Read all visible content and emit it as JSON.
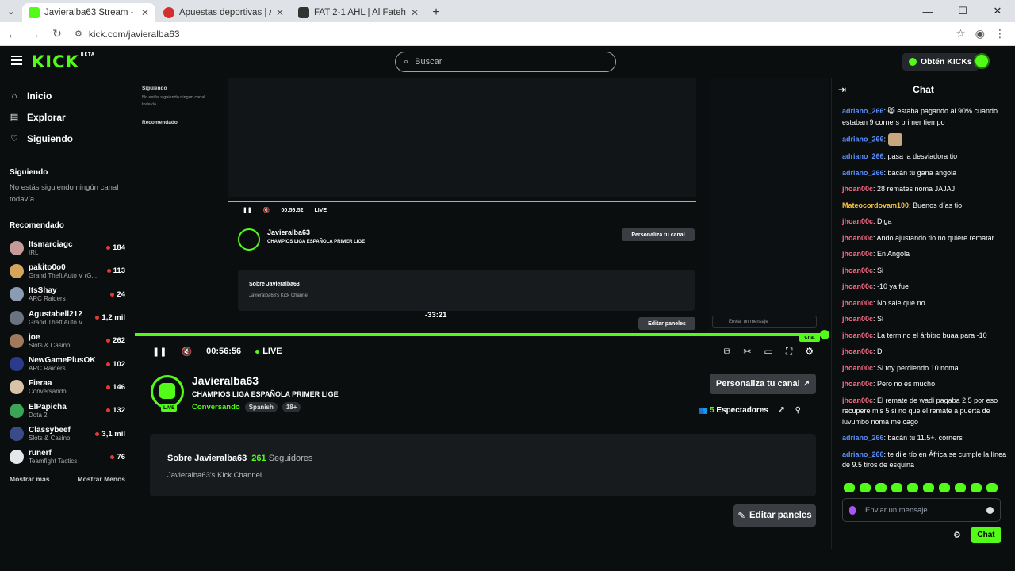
{
  "browser": {
    "tabs": [
      {
        "title": "Javieralba63 Stream - Watch Li",
        "active": true,
        "favicon_color": "#53fc18"
      },
      {
        "title": "Apuestas deportivas | Apuestas",
        "active": false,
        "favicon_color": "#d32f2f"
      },
      {
        "title": "FAT 2-1 AHL | Al Fateh vs Al Ahl",
        "active": false,
        "favicon_color": "#333333"
      }
    ],
    "url": "kick.com/javieralba63"
  },
  "header": {
    "logo": "KICK",
    "logo_badge": "BETA",
    "search_placeholder": "Buscar",
    "get_kicks": "Obtén KICKs"
  },
  "sidebar": {
    "nav": [
      {
        "label": "Inicio",
        "icon": "home-icon"
      },
      {
        "label": "Explorar",
        "icon": "explore-icon"
      },
      {
        "label": "Siguiendo",
        "icon": "heart-icon"
      }
    ],
    "following_title": "Siguiendo",
    "following_empty": "No estás siguiendo ningún canal todavía.",
    "recommended_title": "Recomendado",
    "recommended": [
      {
        "name": "Itsmarciagc",
        "category": "IRL",
        "viewers": "184",
        "color": "#c79a9a"
      },
      {
        "name": "pakito0o0",
        "category": "Grand Theft Auto V (G...",
        "viewers": "113",
        "color": "#d4a55a"
      },
      {
        "name": "ItsShay",
        "category": "ARC Raiders",
        "viewers": "24",
        "color": "#8b9bb4"
      },
      {
        "name": "Agustabell212",
        "category": "Grand Theft Auto V...",
        "viewers": "1,2 mil",
        "color": "#6b7280"
      },
      {
        "name": "joe",
        "category": "Slots & Casino",
        "viewers": "262",
        "color": "#a07a5c"
      },
      {
        "name": "NewGamePlusOK",
        "category": "ARC Raiders",
        "viewers": "102",
        "color": "#2b3a8a"
      },
      {
        "name": "Fieraa",
        "category": "Conversando",
        "viewers": "146",
        "color": "#d9c3a8"
      },
      {
        "name": "ElPapicha",
        "category": "Dota 2",
        "viewers": "132",
        "color": "#3aa655"
      },
      {
        "name": "Classybeef",
        "category": "Slots & Casino",
        "viewers": "3,1 mil",
        "color": "#3b4b8a"
      },
      {
        "name": "runerf",
        "category": "Teamfight Tactics",
        "viewers": "76",
        "color": "#e5e7eb"
      }
    ],
    "show_more": "Mostrar más",
    "show_less": "Mostrar Menos"
  },
  "player": {
    "time": "00:56:56",
    "live": "LIVE",
    "hover_time": "-33:21",
    "inner_time": "00:56:52",
    "inner_chat": "Chat"
  },
  "channel": {
    "name": "Javieralba63",
    "title": "CHAMPIOS LIGA ESPAÑOLA PRIMER LIGE",
    "category": "Conversando",
    "tags": [
      "Spanish",
      "18+"
    ],
    "live_badge": "LIVE",
    "customize": "Personaliza tu canal",
    "viewers": "5",
    "viewers_label": "Espectadores",
    "about_prefix": "Sobre Javieralba63",
    "followers": "261",
    "followers_label": "Seguidores",
    "description": "Javieralba63's Kick Channel",
    "edit_panels": "Editar paneles"
  },
  "chat": {
    "title": "Chat",
    "messages": [
      {
        "user": "adriano_266",
        "color": "#5b8ff9",
        "text": "😸 estaba pagando al 90% cuando estaban 9 corners primer tiempo"
      },
      {
        "user": "adriano_266",
        "color": "#5b8ff9",
        "text": ""
      },
      {
        "user": "adriano_266",
        "color": "#5b8ff9",
        "text": "pasa la desviadora tio"
      },
      {
        "user": "adriano_266",
        "color": "#5b8ff9",
        "text": "bacán tu gana angola"
      },
      {
        "user": "jhoan00c",
        "color": "#ff6b8a",
        "text": "28 remates noma JAJAJ"
      },
      {
        "user": "Mateocordovam100",
        "color": "#f5c542",
        "text": "Buenos días tio"
      },
      {
        "user": "jhoan00c",
        "color": "#ff6b8a",
        "text": "Diga"
      },
      {
        "user": "jhoan00c",
        "color": "#ff6b8a",
        "text": "Ando ajustando tio no quiere rematar"
      },
      {
        "user": "jhoan00c",
        "color": "#ff6b8a",
        "text": "En Angola"
      },
      {
        "user": "jhoan00c",
        "color": "#ff6b8a",
        "text": "Si"
      },
      {
        "user": "jhoan00c",
        "color": "#ff6b8a",
        "text": "-10 ya fue"
      },
      {
        "user": "jhoan00c",
        "color": "#ff6b8a",
        "text": "No sale que no"
      },
      {
        "user": "jhoan00c",
        "color": "#ff6b8a",
        "text": "Si"
      },
      {
        "user": "jhoan00c",
        "color": "#ff6b8a",
        "text": "La termino el árbitro buaa para -10"
      },
      {
        "user": "jhoan00c",
        "color": "#ff6b8a",
        "text": "Di"
      },
      {
        "user": "jhoan00c",
        "color": "#ff6b8a",
        "text": "Si toy perdiendo 10 noma"
      },
      {
        "user": "jhoan00c",
        "color": "#ff6b8a",
        "text": "Pero no es mucho"
      },
      {
        "user": "jhoan00c",
        "color": "#ff6b8a",
        "text": "El remate de wadi pagaba 2.5 por eso recupere mis 5 si no que el remate a puerta de luvumbo noma me cago"
      },
      {
        "user": "adriano_266",
        "color": "#5b8ff9",
        "text": "bacán tu 11.5+. córners"
      },
      {
        "user": "adriano_266",
        "color": "#5b8ff9",
        "text": "te dije tío en África se cumple la línea de 9.5 tiros de esquina"
      }
    ],
    "input_placeholder": "Enviar un mensaje",
    "send": "Chat"
  }
}
